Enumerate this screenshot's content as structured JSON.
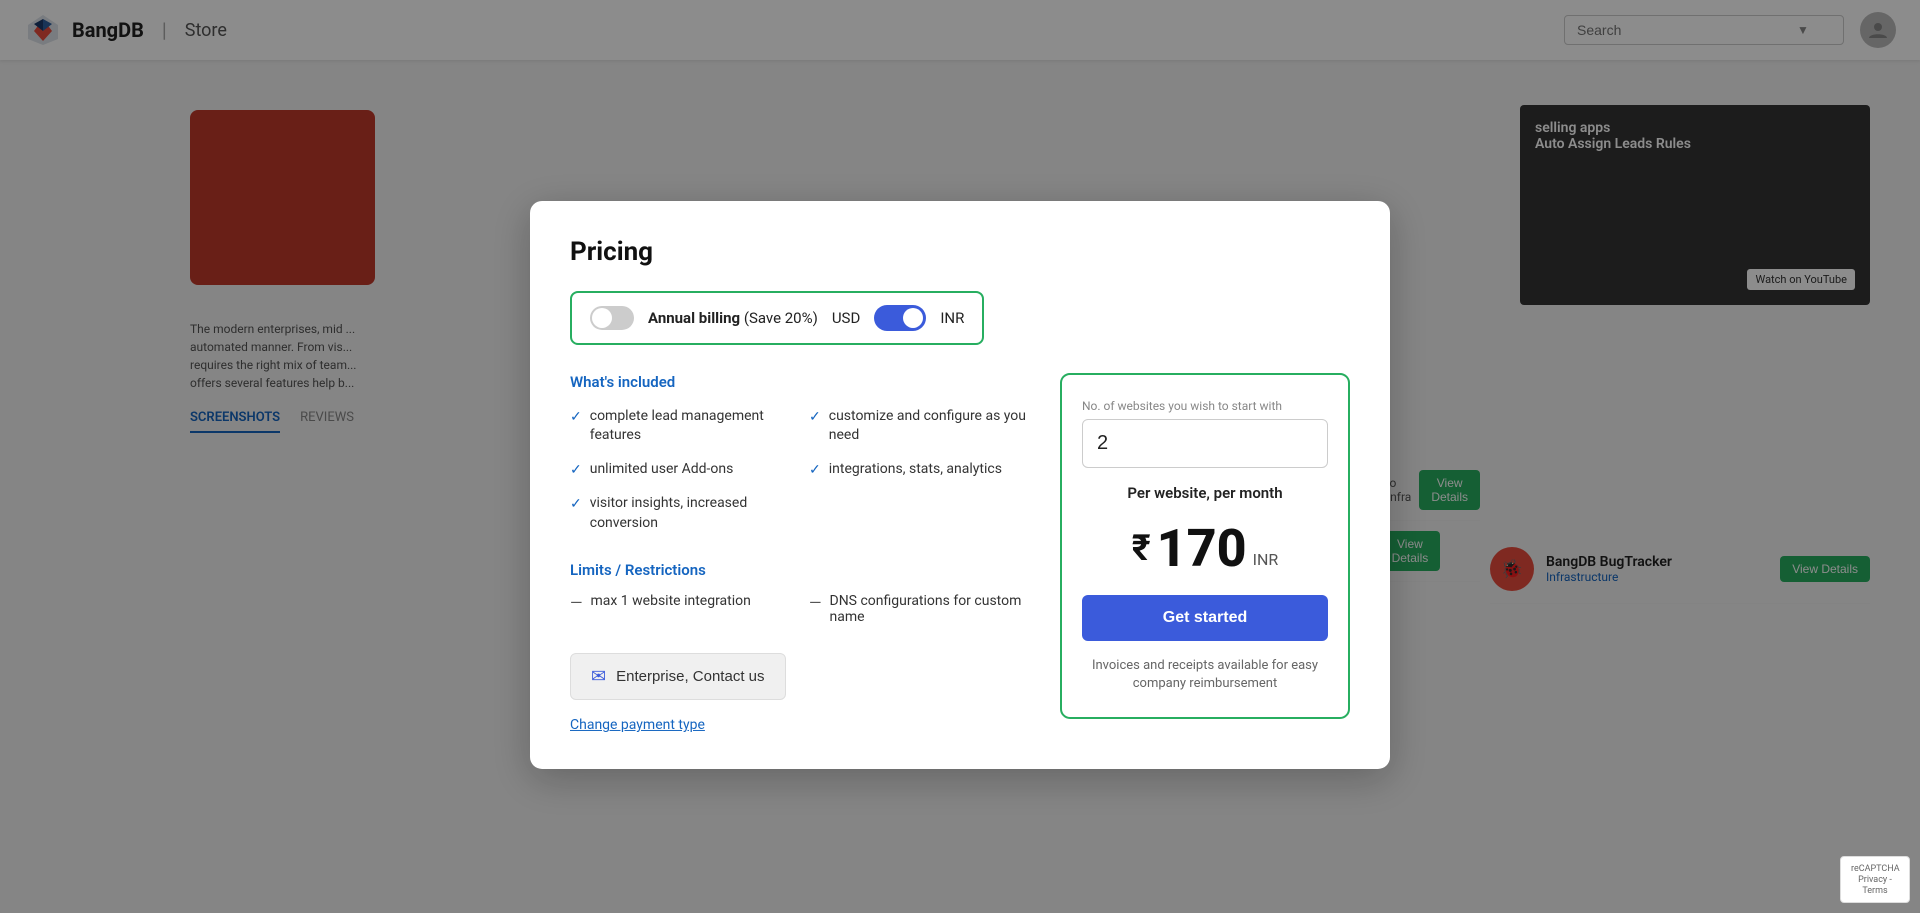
{
  "header": {
    "logo_text": "BangDB",
    "divider": "|",
    "store_label": "Store",
    "search_placeholder": "Search",
    "user_icon": "👤"
  },
  "modal": {
    "title": "Pricing",
    "billing": {
      "annual_label": "Annual billing",
      "save_text": "(Save 20%)",
      "currency_usd": "USD",
      "currency_inr": "INR",
      "toggle_state": "INR"
    },
    "whats_included": {
      "section_title": "What's included",
      "features": [
        {
          "text": "complete lead management features"
        },
        {
          "text": "customize and configure as you need"
        },
        {
          "text": "unlimited user Add-ons"
        },
        {
          "text": "integrations, stats, analytics"
        },
        {
          "text": "visitor insights, increased conversion"
        }
      ]
    },
    "limits": {
      "section_title": "Limits / Restrictions",
      "items": [
        {
          "text": "max 1 website integration"
        },
        {
          "text": "DNS configurations for custom name"
        }
      ]
    },
    "enterprise_button_label": "Enterprise, Contact us",
    "change_payment_link": "Change payment type",
    "pricing_panel": {
      "websites_label": "No. of websites you wish to start with",
      "websites_value": "2",
      "per_website_label": "Per website, per month",
      "price_symbol": "₹",
      "price_amount": "170",
      "price_currency": "INR",
      "get_started_label": "Get started",
      "invoice_note": "Invoices and receipts available for easy company reimbursement"
    }
  },
  "background": {
    "screenshots_tab": "SCREENSHOTS",
    "reviews_tab": "REVIEWS",
    "app_name": "BangDB BugTracker",
    "app_category": "Infrastructure",
    "view_details": "View Details",
    "selling_apps_label": "selling apps",
    "auto_assign_label": "Auto Assign Leads Rules",
    "watch_youtube": "Watch on YouTube",
    "description": "The modern enterprises, mid ... automated manner. From vis... requires the right mix of team... offers several features help b..."
  },
  "recaptcha": {
    "label": "reCAPTCHA Privacy - Terms"
  }
}
